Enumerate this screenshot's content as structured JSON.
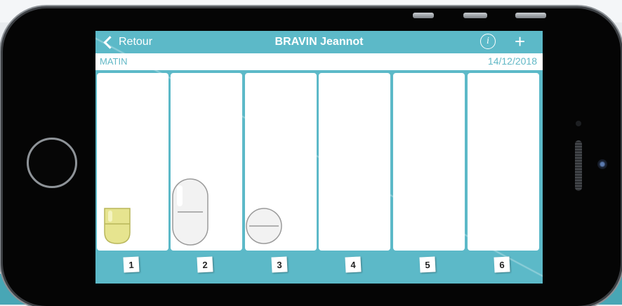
{
  "nav": {
    "back_label": "Retour",
    "title": "BRAVIN Jeannot",
    "info_icon": "info-icon",
    "add_icon": "plus-icon"
  },
  "subbar": {
    "period": "MATIN",
    "date": "14/12/2018"
  },
  "slots": [
    {
      "number": "1",
      "pill": "yellow-capsule"
    },
    {
      "number": "2",
      "pill": "white-oblong-tablet"
    },
    {
      "number": "3",
      "pill": "white-round-tablet"
    },
    {
      "number": "4",
      "pill": ""
    },
    {
      "number": "5",
      "pill": ""
    },
    {
      "number": "6",
      "pill": ""
    }
  ],
  "colors": {
    "accent": "#5cb9c8",
    "capsule": "#e6e48f",
    "tablet": "#f2f2f2"
  }
}
